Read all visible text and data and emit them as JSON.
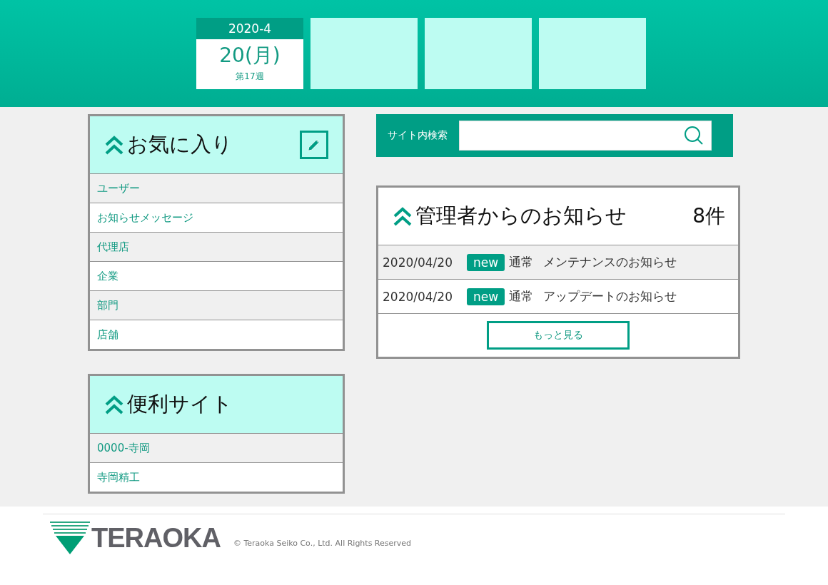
{
  "calendar": {
    "month": "2020-4",
    "day": "20(月)",
    "week": "第17週"
  },
  "favorites": {
    "title": "お気に入り",
    "items": [
      {
        "label": "ユーザー"
      },
      {
        "label": "お知らせメッセージ"
      },
      {
        "label": "代理店"
      },
      {
        "label": "企業"
      },
      {
        "label": "部門"
      },
      {
        "label": "店舗"
      }
    ]
  },
  "useful_sites": {
    "title": "便利サイト",
    "items": [
      {
        "label": "0000-寺岡"
      },
      {
        "label": "寺岡精工"
      }
    ]
  },
  "search": {
    "label": "サイト内検索"
  },
  "notices": {
    "title": "管理者からのお知らせ",
    "count": "8件",
    "rows": [
      {
        "date": "2020/04/20",
        "badge": "new",
        "category": "通常",
        "subject": "メンテナンスのお知らせ"
      },
      {
        "date": "2020/04/20",
        "badge": "new",
        "category": "通常",
        "subject": "アップデートのお知らせ"
      }
    ],
    "more_button": "もっと見る"
  },
  "footer": {
    "logo": "TERAOKA",
    "copyright": "© Teraoka Seiko Co., Ltd. All Rights Reserved"
  }
}
